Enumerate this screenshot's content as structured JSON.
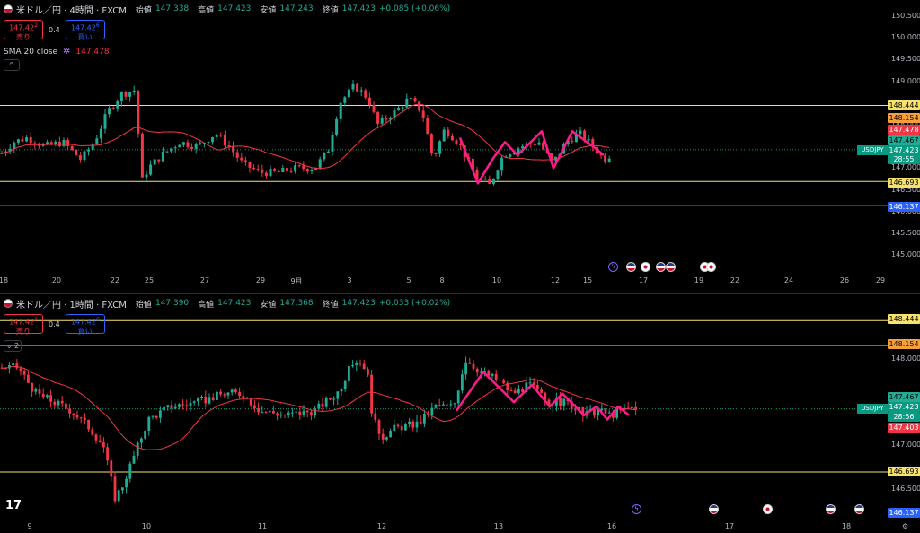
{
  "pane1": {
    "symbol": "米ドル／円 · 4時間 · FXCM",
    "open_label": "始値",
    "open": "147.338",
    "high_label": "高値",
    "high": "147.423",
    "low_label": "安値",
    "low": "147.243",
    "close_label": "終値",
    "close": "147.423",
    "change": "+0.085 (+0.06%)",
    "sell_price": "147.42",
    "sell_sup": "2",
    "sell_label": "売り",
    "buy_price": "147.42",
    "buy_sup": "6",
    "buy_label": "買い",
    "spread": "0.4",
    "sma_label": "SMA 20 close",
    "sma_value": "147.478",
    "collapse": "^",
    "y_ticks": [
      "150.500",
      "150.000",
      "149.500",
      "149.000",
      "148.500",
      "148.000",
      "147.500",
      "147.000",
      "146.500",
      "146.000",
      "145.500",
      "145.000"
    ],
    "x_ticks": [
      "18",
      "20",
      "22",
      "25",
      "27",
      "29",
      "9月",
      "3",
      "5",
      "8",
      "10",
      "12",
      "15",
      "17",
      "19",
      "22",
      "24",
      "26",
      "29"
    ],
    "price_labels": [
      {
        "text": "148.444",
        "bg": "#f7e36b",
        "fg": "#000"
      },
      {
        "text": "148.154",
        "bg": "#f5a03c",
        "fg": "#000"
      },
      {
        "text": "147.478",
        "bg": "#f23645",
        "fg": "#fff"
      },
      {
        "text": "147.467",
        "bg": "#22ab94",
        "fg": "#000"
      },
      {
        "text": "147.423",
        "bg": "#089981",
        "fg": "#fff"
      },
      {
        "text": "28:55",
        "bg": "#089981",
        "fg": "#fff"
      },
      {
        "text": "146.693",
        "bg": "#f7e36b",
        "fg": "#000"
      },
      {
        "text": "146.137",
        "bg": "#2962ff",
        "fg": "#fff"
      }
    ],
    "sym_tag": "USDJPY"
  },
  "pane2": {
    "symbol": "米ドル／円 · 1時間 · FXCM",
    "open_label": "始値",
    "open": "147.390",
    "high_label": "高値",
    "high": "147.423",
    "low_label": "安値",
    "low": "147.368",
    "close_label": "終値",
    "close": "147.423",
    "change": "+0.033 (+0.02%)",
    "sell_price": "147.42",
    "sell_sup": "2",
    "sell_label": "売り",
    "buy_price": "147.42",
    "buy_sup": "6",
    "buy_label": "買い",
    "spread": "0.4",
    "collapse": "⌄ 2",
    "y_ticks": [
      "148.000",
      "147.500",
      "147.000",
      "146.500"
    ],
    "x_ticks": [
      "9",
      "10",
      "11",
      "12",
      "13",
      "16",
      "17",
      "18"
    ],
    "price_labels": [
      {
        "text": "148.444",
        "bg": "#f7e36b",
        "fg": "#000"
      },
      {
        "text": "148.154",
        "bg": "#f5a03c",
        "fg": "#000"
      },
      {
        "text": "147.467",
        "bg": "#22ab94",
        "fg": "#000"
      },
      {
        "text": "147.423",
        "bg": "#089981",
        "fg": "#fff"
      },
      {
        "text": "28:56",
        "bg": "#089981",
        "fg": "#fff"
      },
      {
        "text": "147.403",
        "bg": "#f23645",
        "fg": "#fff"
      },
      {
        "text": "146.693",
        "bg": "#f7e36b",
        "fg": "#000"
      },
      {
        "text": "146.137",
        "bg": "#2962ff",
        "fg": "#fff"
      }
    ],
    "sym_tag": "USDJPY"
  },
  "logo": "17",
  "colors": {
    "up": "#22ab94",
    "down": "#f23645",
    "sma": "#f23645",
    "zigzag": "#ff1a8c",
    "hline_yellow": "#f7e36b",
    "hline_orange": "#f5a03c",
    "hline_blue": "#2962ff"
  }
}
